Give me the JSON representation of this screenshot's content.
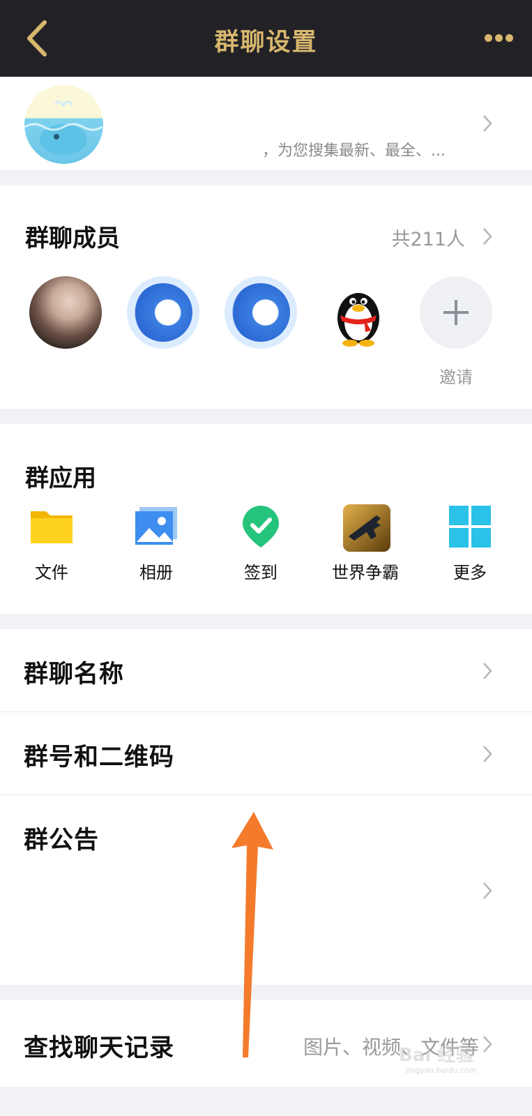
{
  "header": {
    "title": "群聊设置"
  },
  "group": {
    "description": "，为您搜集最新、最全、..."
  },
  "members": {
    "title": "群聊成员",
    "count": "共211人",
    "invite_label": "邀请"
  },
  "apps": {
    "title": "群应用",
    "items": [
      {
        "label": "文件",
        "icon": "folder-icon"
      },
      {
        "label": "相册",
        "icon": "album-icon"
      },
      {
        "label": "签到",
        "icon": "checkin-icon"
      },
      {
        "label": "世界争霸",
        "icon": "game-icon"
      },
      {
        "label": "更多",
        "icon": "grid-more-icon"
      }
    ]
  },
  "settings": {
    "name_label": "群聊名称",
    "qrcode_label": "群号和二维码",
    "announcement_label": "群公告",
    "search_label": "查找聊天记录",
    "search_hint": "图片、视频、文件等"
  },
  "watermark": {
    "brand": "Bai 经验",
    "url": "jingyan.baidu.com"
  },
  "colors": {
    "header_bg": "#222226",
    "header_accent": "#d8b76e",
    "arrow": "#f47a2c"
  }
}
